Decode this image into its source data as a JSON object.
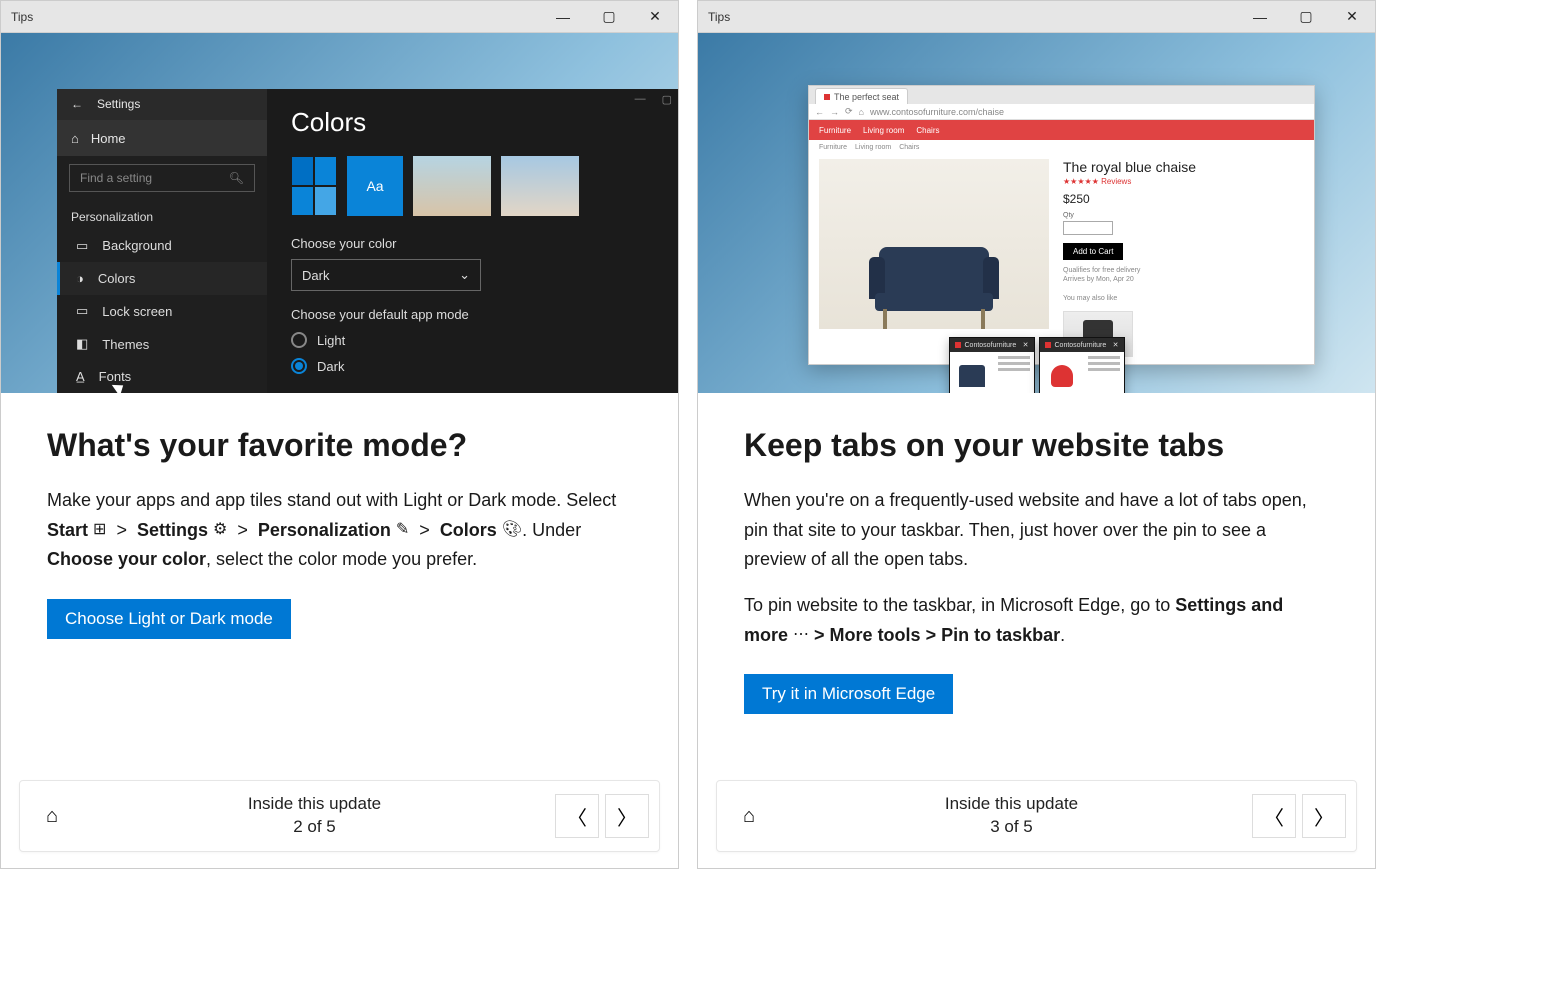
{
  "left": {
    "titlebar": {
      "title": "Tips"
    },
    "settings": {
      "app_name": "Settings",
      "home": "Home",
      "search_placeholder": "Find a setting",
      "section": "Personalization",
      "items": [
        "Background",
        "Colors",
        "Lock screen",
        "Themes",
        "Fonts"
      ],
      "heading": "Colors",
      "choose_color_label": "Choose your color",
      "choose_color_value": "Dark",
      "default_mode_label": "Choose your default app mode",
      "option_light": "Light",
      "option_dark": "Dark"
    },
    "tip": {
      "heading": "What's your favorite mode?",
      "p1_a": "Make your apps and app tiles stand out with Light or Dark mode. Select ",
      "p1_start": "Start",
      "p1_settings": "Settings",
      "p1_personalization": "Personalization",
      "p1_colors": "Colors",
      "p1_b": ". Under ",
      "p1_choose": "Choose your color",
      "p1_c": ", select the color mode you prefer.",
      "cta": "Choose Light or Dark mode"
    },
    "footer": {
      "title": "Inside this update",
      "position": "2 of 5"
    }
  },
  "right": {
    "titlebar": {
      "title": "Tips"
    },
    "browser": {
      "tab_name": "The perfect seat",
      "url": "www.contosofurniture.com/chaise",
      "nav": [
        "Furniture",
        "Living room",
        "Chairs"
      ],
      "breadcrumbs": [
        "Furniture",
        "Living room",
        "Chairs"
      ],
      "product_name": "The royal blue chaise",
      "rating_text": "Reviews",
      "price": "$250",
      "qty_label": "Qty",
      "addcart": "Add to Cart",
      "ship1": "Qualifies for free delivery",
      "ship2": "Arrives by Mon, Apr 20",
      "related": "You may also like"
    },
    "taskbar_previews": {
      "label": "Contosofurniture"
    },
    "tip": {
      "heading": "Keep tabs on your website tabs",
      "p1": "When you're on a frequently-used website and have a lot of tabs open, pin that site to your taskbar. Then, just hover over the pin to see a preview of all the open tabs.",
      "p2_a": "To pin website to the taskbar, in Microsoft Edge, go to ",
      "p2_settings_more": "Settings and more",
      "p2_path": " > More tools > Pin to taskbar",
      "p2_end": ".",
      "cta": "Try it in Microsoft Edge"
    },
    "footer": {
      "title": "Inside this update",
      "position": "3 of 5"
    }
  }
}
